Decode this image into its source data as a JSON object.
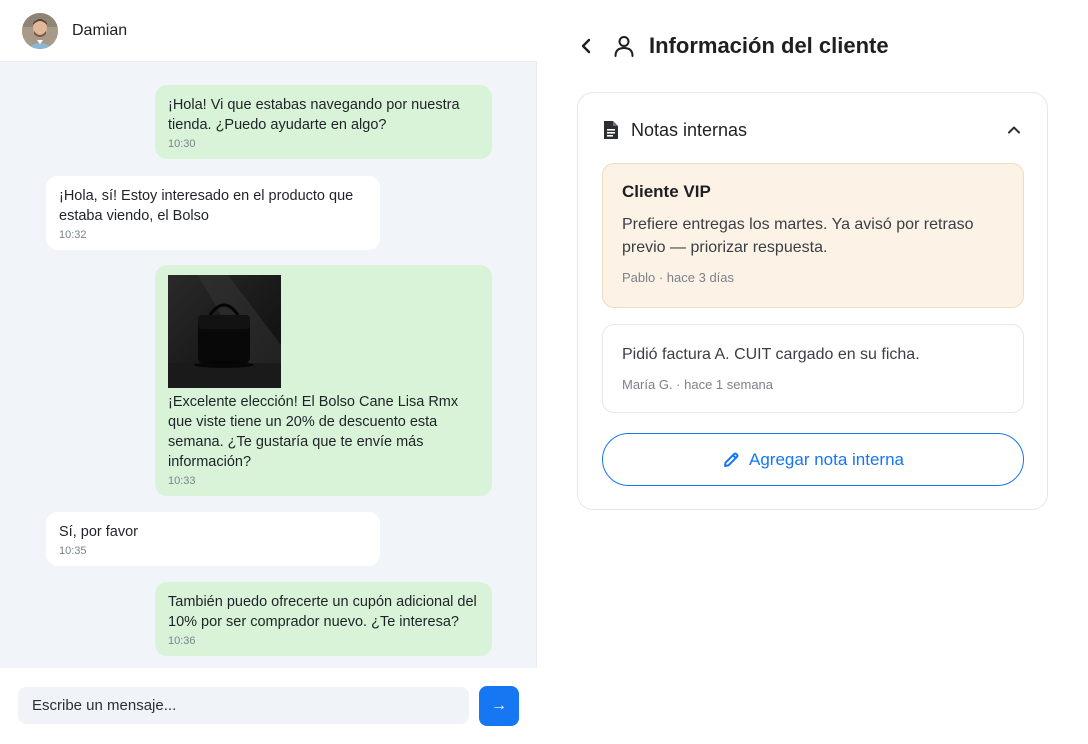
{
  "chat": {
    "contact_name": "Damian",
    "messages": [
      {
        "direction": "out",
        "text": "¡Hola! Vi que estabas navegando por nuestra tienda. ¿Puedo ayudarte en algo?",
        "time": "10:30"
      },
      {
        "direction": "in",
        "text": "¡Hola, sí! Estoy interesado en el producto que estaba viendo, el Bolso",
        "time": "10:32"
      },
      {
        "direction": "out",
        "text": "¡Excelente elección! El Bolso Cane Lisa Rmx que viste tiene un 20% de descuento esta semana. ¿Te gustaría que te envíe más información?",
        "time": "10:33",
        "image": "handbag-photo"
      },
      {
        "direction": "in",
        "text": "Sí, por favor",
        "time": "10:35"
      },
      {
        "direction": "out",
        "text": "También puedo ofrecerte un cupón adicional del 10% por ser comprador nuevo. ¿Te interesa?",
        "time": "10:36"
      }
    ],
    "composer": {
      "placeholder": "Escribe un mensaje...",
      "send_icon": "→"
    }
  },
  "info": {
    "title": "Información del cliente",
    "section_title": "Notas internas",
    "notes": [
      {
        "title": "Cliente VIP",
        "text": "Prefiere entregas los martes. Ya avisó por retraso previo — priorizar respuesta.",
        "meta": "Pablo · hace 3 días"
      },
      {
        "text": "Pidió factura A. CUIT cargado en su ficha.",
        "meta": "María G. · hace 1 semana"
      }
    ],
    "add_button_label": "Agregar nota interna"
  },
  "colors": {
    "accent": "#1677f2",
    "outgoing_bubble": "#d9f3d9",
    "incoming_bubble": "#ffffff",
    "vip_note_bg": "#fcf2e6",
    "chat_bg": "#f1f4f8"
  }
}
